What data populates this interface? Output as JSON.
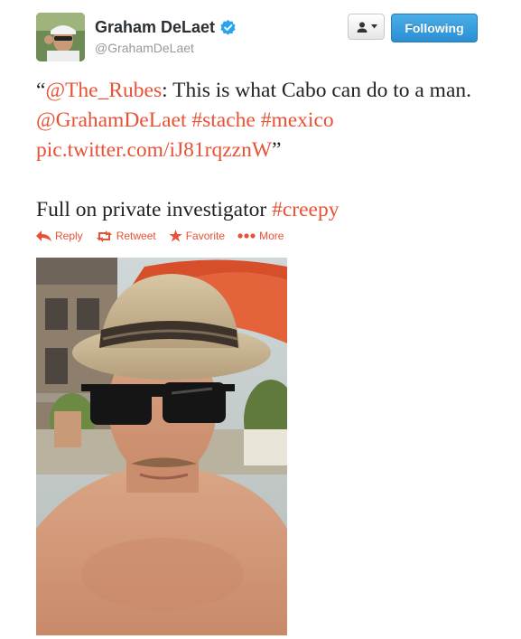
{
  "profile": {
    "name": "Graham DeLaet",
    "handle": "@GrahamDeLaet"
  },
  "header_buttons": {
    "follow_label": "Following"
  },
  "tweet": {
    "open_quote": "“",
    "mention_1": "@The_Rubes",
    "text_1": ": This is what Cabo can do to a man. ",
    "mention_2": "@GrahamDeLaet",
    "hashtag_1": "#stache",
    "hashtag_2": "#mexico",
    "pic_link": "pic.twitter.com/iJ81rqzznW",
    "close_quote": "”",
    "text_2": "Full on private investigator ",
    "hashtag_3": "#creepy"
  },
  "actions": {
    "reply": "Reply",
    "retweet": "Retweet",
    "favorite": "Favorite",
    "more": "More"
  },
  "colors": {
    "link": "#e85135",
    "follow_button": "#2a8fd2",
    "verified": "#2aa3ef"
  }
}
